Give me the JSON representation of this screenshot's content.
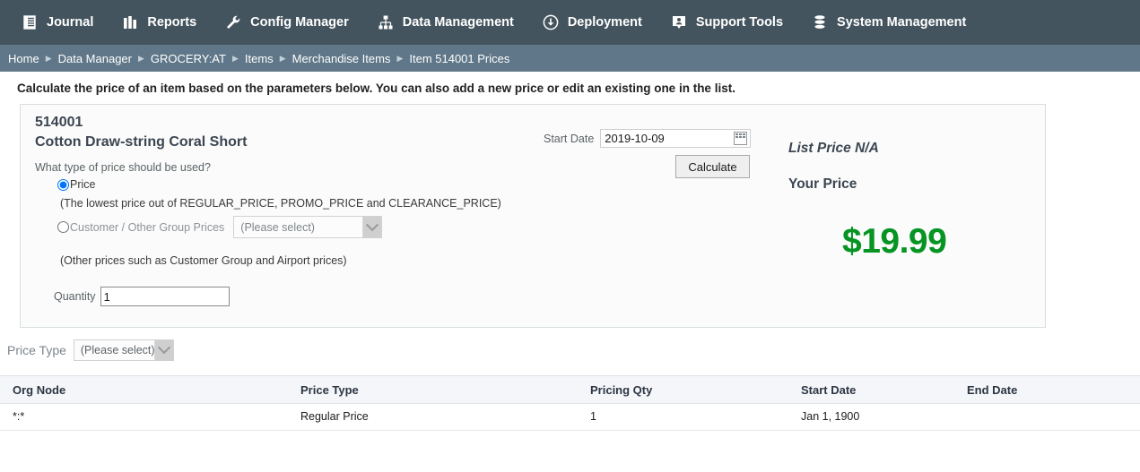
{
  "topnav": {
    "items": [
      {
        "label": "Journal",
        "icon": "journal-icon"
      },
      {
        "label": "Reports",
        "icon": "bar-chart-icon"
      },
      {
        "label": "Config Manager",
        "icon": "wrench-icon"
      },
      {
        "label": "Data Management",
        "icon": "hierarchy-icon"
      },
      {
        "label": "Deployment",
        "icon": "cloud-download-icon"
      },
      {
        "label": "Support Tools",
        "icon": "person-card-icon"
      },
      {
        "label": "System Management",
        "icon": "database-icon"
      }
    ]
  },
  "breadcrumb": {
    "items": [
      "Home",
      "Data Manager",
      "GROCERY:AT",
      "Items",
      "Merchandise Items",
      "Item 514001 Prices"
    ],
    "separator": "▶"
  },
  "instruction": "Calculate the price of an item based on the parameters below. You can also add a new price or edit an existing one in the list.",
  "panel": {
    "item_number": "514001",
    "item_name": "Cotton Draw-string Coral Short",
    "question": "What type of price should be used?",
    "radio_price_label": "Price",
    "radio_price_hint": "(The lowest price out of REGULAR_PRICE, PROMO_PRICE and CLEARANCE_PRICE)",
    "radio_group_label": "Customer / Other Group Prices",
    "radio_group_hint": "(Other prices such as Customer Group and Airport prices)",
    "group_select_value": "(Please select)",
    "quantity_label": "Quantity",
    "quantity_value": "1",
    "start_date_label": "Start Date",
    "start_date_value": "2019-10-09",
    "calculate_label": "Calculate",
    "list_price_label": "List Price N/A",
    "your_price_label": "Your Price",
    "price_value": "$19.99",
    "price_color": "#069422"
  },
  "price_type_filter": {
    "label": "Price Type",
    "value": "(Please select)"
  },
  "table": {
    "columns": [
      "Org Node",
      "Price Type",
      "Pricing Qty",
      "Start Date",
      "End Date"
    ],
    "rows": [
      {
        "org_node": "*:*",
        "price_type": "Regular Price",
        "pricing_qty": "1",
        "start_date": "Jan 1, 1900",
        "end_date": ""
      }
    ]
  },
  "colors": {
    "nav_bg": "#44545e",
    "breadcrumb_bg": "#5f7788",
    "accent_green": "#069422"
  }
}
